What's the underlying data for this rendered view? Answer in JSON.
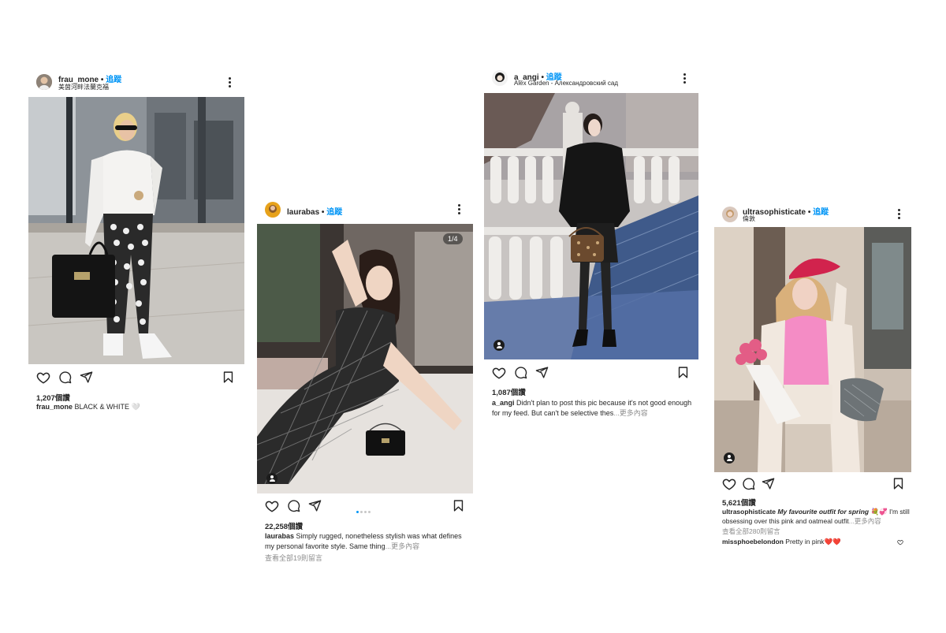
{
  "posts": [
    {
      "username": "frau_mone",
      "follow": "追蹤",
      "location": "美茵河畔法蘭克福",
      "likes": "1,207個讚",
      "caption_user": "frau_mone",
      "caption_text": "BLACK & WHITE 🤍"
    },
    {
      "username": "laurabas",
      "follow": "追蹤",
      "counter": "1/4",
      "likes": "22,258個讚",
      "caption_user": "laurabas",
      "caption_text": "Simply rugged, nonetheless stylish was what defines my personal favorite style. Same thing",
      "more": "...更多內容",
      "view_comments": "查看全部19則留言"
    },
    {
      "username": "a_angi",
      "follow": "追蹤",
      "location": "Alex Garden - Александровский сад",
      "likes": "1,087個讚",
      "caption_user": "a_angi",
      "caption_text": "Didn't plan to post this pic because it's not good enough for my feed. But can't be selective thes",
      "more": "...更多內容"
    },
    {
      "username": "ultrasophisticate",
      "follow": "追蹤",
      "location": "倫敦",
      "likes": "5,621個讚",
      "caption_user": "ultrasophisticate",
      "caption_italic": "My favourite outfit for spring",
      "caption_emoji": " 💐💞",
      "caption_text": " I'm still obsessing over this pink and oatmeal outfit",
      "more": "...更多內容",
      "view_comments": "查看全部280則留言",
      "comment_user": "missphoebelondon",
      "comment_text": "Pretty in pink",
      "comment_emoji": "❤️❤️"
    }
  ],
  "icons": [
    "heart-icon",
    "comment-icon",
    "share-icon",
    "bookmark-icon",
    "more-icon",
    "tagged-user-icon"
  ],
  "colors": {
    "follow": "#0095f6",
    "text": "#262626",
    "muted": "#8e8e8e"
  }
}
